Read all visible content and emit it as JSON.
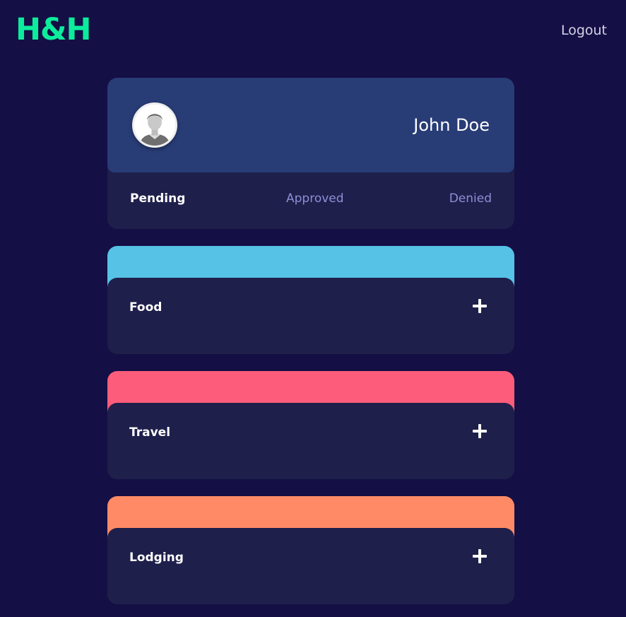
{
  "header": {
    "logo": "H&H",
    "logout_label": "Logout"
  },
  "profile": {
    "name": "John Doe",
    "avatar_icon": "user-avatar-icon",
    "tabs": [
      {
        "label": "Pending",
        "active": true
      },
      {
        "label": "Approved",
        "active": false
      },
      {
        "label": "Denied",
        "active": false
      }
    ]
  },
  "categories": [
    {
      "title": "Food",
      "color": "#56c2e6",
      "add_icon": "plus-icon"
    },
    {
      "title": "Travel",
      "color": "#fd5c7a",
      "add_icon": "plus-icon"
    },
    {
      "title": "Lodging",
      "color": "#ff8a65",
      "add_icon": "plus-icon"
    }
  ],
  "colors": {
    "background": "#140f45",
    "card": "#1e1f4b",
    "profile_header": "#283c76",
    "brand": "#0cec9c",
    "inactive_tab": "#8d8fd6"
  }
}
